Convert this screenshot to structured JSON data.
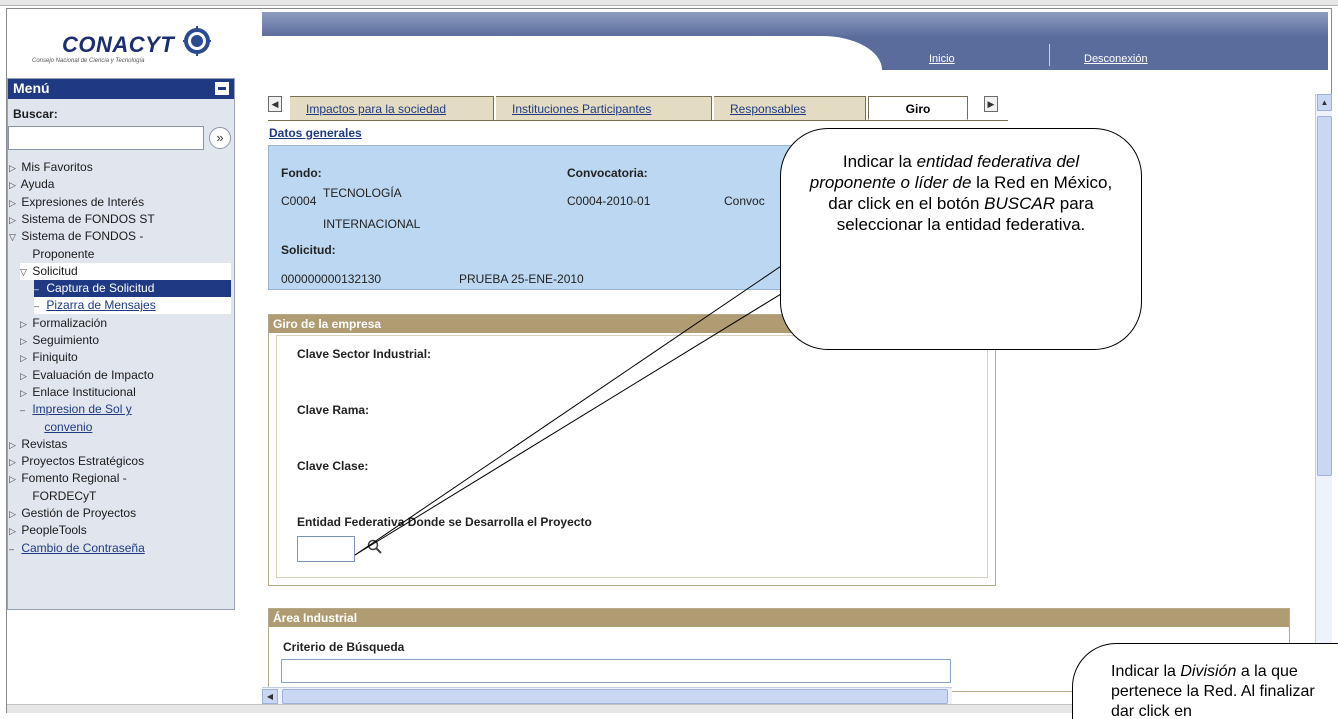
{
  "logo": {
    "wordmark": "CONACYT",
    "tagline": "Consejo Nacional de Ciencia y Tecnología"
  },
  "header": {
    "links": [
      "Inicio",
      "Desconexión"
    ]
  },
  "menu": {
    "title": "Menú",
    "search_label": "Buscar:",
    "items": [
      {
        "label": "Mis Favoritos",
        "marker": "▷"
      },
      {
        "label": "Ayuda",
        "marker": "▷"
      },
      {
        "label": "Expresiones de Interés",
        "marker": "▷"
      },
      {
        "label": "Sistema de FONDOS ST",
        "marker": "▷"
      },
      {
        "label": "Sistema de FONDOS -",
        "marker": "▽"
      },
      {
        "label": "Proponente",
        "marker": ""
      },
      {
        "label": "Solicitud",
        "marker": "▽"
      },
      {
        "label": "Captura de Solicitud",
        "marker": "–"
      },
      {
        "label": "Pizarra de Mensajes",
        "marker": "–"
      },
      {
        "label": "Formalización",
        "marker": "▷"
      },
      {
        "label": "Seguimiento",
        "marker": "▷"
      },
      {
        "label": "Finiquito",
        "marker": "▷"
      },
      {
        "label": "Evaluación de Impacto",
        "marker": "▷"
      },
      {
        "label": "Enlace Institucional",
        "marker": "▷"
      },
      {
        "label": "Impresion de Sol y",
        "marker": "–"
      },
      {
        "label": "convenio",
        "marker": ""
      },
      {
        "label": "Revistas",
        "marker": "▷"
      },
      {
        "label": "Proyectos Estratégicos",
        "marker": "▷"
      },
      {
        "label": "Fomento Regional -",
        "marker": "▷"
      },
      {
        "label": "FORDECyT",
        "marker": ""
      },
      {
        "label": "Gestión de Proyectos",
        "marker": "▷"
      },
      {
        "label": "PeopleTools",
        "marker": "▷"
      },
      {
        "label": "Cambio de Contraseña",
        "marker": "–"
      }
    ]
  },
  "tabs": [
    "Impactos para la sociedad",
    "Instituciones Participantes",
    "Responsables",
    "Giro"
  ],
  "datos_generales": {
    "title": "Datos generales",
    "fondo_label": "Fondo:",
    "fondo_code": "C0004",
    "fondo_name_1": "TECNOLOGÍA",
    "fondo_name_2": "INTERNACIONAL",
    "convocatoria_label": "Convocatoria:",
    "convocatoria_code": "C0004-2010-01",
    "convocatoria_name": "Convoc",
    "solicitud_label": "Solicitud:",
    "solicitud_number": "000000000132130",
    "solicitud_name": "PRUEBA 25-ENE-2010"
  },
  "giro": {
    "title": "Giro de la empresa",
    "clave_sector": "Clave Sector Industrial:",
    "clave_rama": "Clave Rama:",
    "clave_clase": "Clave Clase:",
    "entidad_label": "Entidad Federativa Donde se Desarrolla el Proyecto"
  },
  "area": {
    "title": "Área Industrial",
    "criterio_label": "Criterio de Búsqueda"
  },
  "callouts": {
    "c1_a": "Indicar la ",
    "c1_b": "entidad federativa del proponente o líder de",
    "c1_c": " la Red en México, dar click en el botón ",
    "c1_d": "BUSCAR",
    "c1_e": " para seleccionar la entidad federativa.",
    "c2_a": "Indicar la ",
    "c2_b": "División",
    "c2_c": " a la que pertenece la Red. Al finalizar dar click en"
  },
  "colors": {
    "menu_header": "#1f3a82",
    "info_panel": "#bcd7f1",
    "section_header": "#b09c72"
  }
}
